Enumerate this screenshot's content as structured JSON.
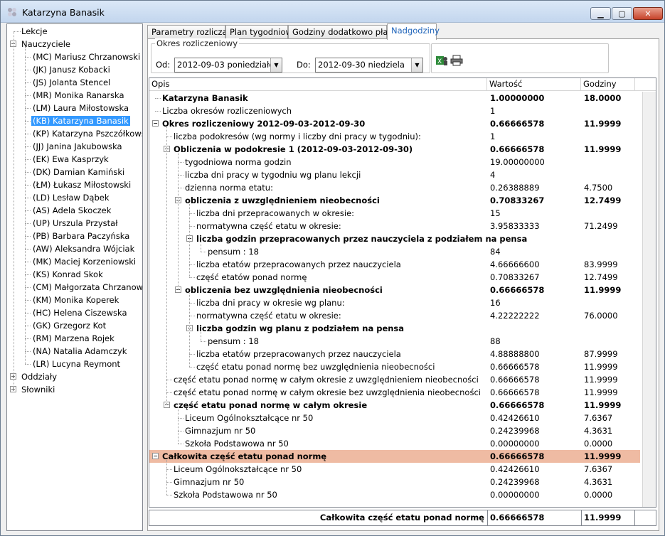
{
  "window": {
    "title": "Katarzyna Banasik",
    "min_glyph": "▁",
    "max_glyph": "▢",
    "close_glyph": "✕"
  },
  "tree": {
    "lekcje": "Lekcje",
    "nauczyciele": "Nauczyciele",
    "teachers": [
      "(MC) Mariusz Chrzanowski",
      "(JK) Janusz Kobacki",
      "(JS) Jolanta Stencel",
      "(MR) Monika Ranarska",
      "(LM) Laura Miłostowska",
      "(KB) Katarzyna Banasik",
      "(KP) Katarzyna Pszczółkowska",
      "(JJ) Janina Jakubowska",
      "(EK) Ewa Kasprzyk",
      "(DK) Damian Kamiński",
      "(ŁM) Łukasz Miłostowski",
      "(LD) Lesław Dąbek",
      "(AS) Adela Skoczek",
      "(UP) Urszula Przystał",
      "(PB) Barbara Paczyńska",
      "(AW) Aleksandra Wójciak",
      "(MK) Maciej Korzeniowski",
      "(KS) Konrad Skok",
      "(CM) Małgorzata Chrzanowska",
      "(KM) Monika Koperek",
      "(HC) Helena Ciszewska",
      "(GK) Grzegorz Kot",
      "(RM) Marzena Rojek",
      "(NA) Natalia Adamczyk",
      "(LR) Lucyna Reymont"
    ],
    "selected_index": 5,
    "oddzialy": "Oddziały",
    "slowniki": "Słowniki"
  },
  "tabs": [
    "Parametry rozliczania",
    "Plan tygodniowy",
    "Godziny dodatkowo płatne",
    "Nadgodziny"
  ],
  "active_tab": 3,
  "period": {
    "group_label": "Okres rozliczeniowy",
    "od_label": "Od:",
    "od_value": "2012-09-03 poniedziałek",
    "do_label": "Do:",
    "do_value": "2012-09-30 niedziela"
  },
  "grid": {
    "headers": [
      "Opis",
      "Wartość",
      "Godziny"
    ],
    "rows": [
      {
        "text": "Katarzyna Banasik",
        "v": "1.00000000",
        "h": "18.0000",
        "lvl": 0,
        "bold": true,
        "exp": false
      },
      {
        "text": "Liczba okresów rozliczeniowych",
        "v": "1",
        "h": "",
        "lvl": 0,
        "bold": false,
        "exp": false
      },
      {
        "text": "Okres rozliczeniowy 2012-09-03-2012-09-30",
        "v": "0.66666578",
        "h": "11.9999",
        "lvl": 0,
        "bold": true,
        "exp": true
      },
      {
        "text": "liczba podokresów (wg normy i liczby dni pracy w tygodniu):",
        "v": "1",
        "h": "",
        "lvl": 1,
        "bold": false,
        "exp": false
      },
      {
        "text": "Obliczenia w podokresie 1 (2012-09-03-2012-09-30)",
        "v": "0.66666578",
        "h": "11.9999",
        "lvl": 1,
        "bold": true,
        "exp": true
      },
      {
        "text": "tygodniowa norma godzin",
        "v": "19.00000000",
        "h": "",
        "lvl": 2,
        "bold": false,
        "exp": false
      },
      {
        "text": "liczba dni pracy w tygodniu wg planu lekcji",
        "v": "4",
        "h": "",
        "lvl": 2,
        "bold": false,
        "exp": false
      },
      {
        "text": "dzienna norma etatu:",
        "v": "0.26388889",
        "h": "4.7500",
        "lvl": 2,
        "bold": false,
        "exp": false
      },
      {
        "text": "obliczenia z  uwzględnieniem nieobecności",
        "v": "0.70833267",
        "h": "12.7499",
        "lvl": 2,
        "bold": true,
        "exp": true
      },
      {
        "text": "liczba dni przepracowanych w okresie:",
        "v": "15",
        "h": "",
        "lvl": 3,
        "bold": false,
        "exp": false
      },
      {
        "text": "normatywna część etatu w okresie:",
        "v": "3.95833333",
        "h": "71.2499",
        "lvl": 3,
        "bold": false,
        "exp": false
      },
      {
        "text": "liczba godzin przepracowanych przez nauczyciela z podziałem na pensa",
        "v": "",
        "h": "",
        "lvl": 3,
        "bold": true,
        "exp": true
      },
      {
        "text": "pensum : 18",
        "v": "84",
        "h": "",
        "lvl": 4,
        "bold": false,
        "exp": false
      },
      {
        "text": "liczba etatów przepracowanych przez nauczyciela",
        "v": "4.66666600",
        "h": "83.9999",
        "lvl": 3,
        "bold": false,
        "exp": false
      },
      {
        "text": "część etatów ponad normę",
        "v": "0.70833267",
        "h": "12.7499",
        "lvl": 3,
        "bold": false,
        "exp": false
      },
      {
        "text": "obliczenia bez  uwzględnienia nieobecności",
        "v": "0.66666578",
        "h": "11.9999",
        "lvl": 2,
        "bold": true,
        "exp": true
      },
      {
        "text": "liczba dni pracy w okresie wg planu:",
        "v": "16",
        "h": "",
        "lvl": 3,
        "bold": false,
        "exp": false
      },
      {
        "text": "normatywna część etatu w okresie:",
        "v": "4.22222222",
        "h": "76.0000",
        "lvl": 3,
        "bold": false,
        "exp": false
      },
      {
        "text": "liczba godzin wg planu z podziałem na pensa",
        "v": "",
        "h": "",
        "lvl": 3,
        "bold": true,
        "exp": true
      },
      {
        "text": "pensum : 18",
        "v": "88",
        "h": "",
        "lvl": 4,
        "bold": false,
        "exp": false
      },
      {
        "text": "liczba etatów przepracowanych przez nauczyciela",
        "v": "4.88888800",
        "h": "87.9999",
        "lvl": 3,
        "bold": false,
        "exp": false
      },
      {
        "text": "część etatu ponad normę bez uwzględnienia nieobecności",
        "v": "0.66666578",
        "h": "11.9999",
        "lvl": 3,
        "bold": false,
        "exp": false
      },
      {
        "text": "część etatu ponad normę w całym okresie  z uwzględnieniem nieobecności",
        "v": "0.66666578",
        "h": "11.9999",
        "lvl": 1,
        "bold": false,
        "exp": false
      },
      {
        "text": "część etatu ponad normę w całym okresie  bez uwzględnienia nieobecności",
        "v": "0.66666578",
        "h": "11.9999",
        "lvl": 1,
        "bold": false,
        "exp": false
      },
      {
        "text": "część etatu ponad normę w całym okresie",
        "v": "0.66666578",
        "h": "11.9999",
        "lvl": 1,
        "bold": true,
        "exp": true
      },
      {
        "text": "Liceum Ogólnokształcące nr 50",
        "v": "0.42426610",
        "h": "7.6367",
        "lvl": 2,
        "bold": false,
        "exp": false
      },
      {
        "text": "Gimnazjum nr 50",
        "v": "0.24239968",
        "h": "4.3631",
        "lvl": 2,
        "bold": false,
        "exp": false
      },
      {
        "text": "Szkoła Podstawowa nr 50",
        "v": "0.00000000",
        "h": "0.0000",
        "lvl": 2,
        "bold": false,
        "exp": false
      },
      {
        "text": "Całkowita część etatu ponad normę",
        "v": "0.66666578",
        "h": "11.9999",
        "lvl": 0,
        "bold": true,
        "exp": true,
        "hl": true
      },
      {
        "text": "Liceum Ogólnokształcące nr 50",
        "v": "0.42426610",
        "h": "7.6367",
        "lvl": 1,
        "bold": false,
        "exp": false
      },
      {
        "text": "Gimnazjum nr 50",
        "v": "0.24239968",
        "h": "4.3631",
        "lvl": 1,
        "bold": false,
        "exp": false
      },
      {
        "text": "Szkoła Podstawowa nr 50",
        "v": "0.00000000",
        "h": "0.0000",
        "lvl": 1,
        "bold": false,
        "exp": false
      }
    ]
  },
  "footer": {
    "label": "Całkowita część etatu ponad normę",
    "value": "0.66666578",
    "hours": "11.9999"
  },
  "colors": {
    "highlight": "#efbba3",
    "selection": "#3399ff",
    "active_tab_text": "#2266bb"
  },
  "icons": [
    "tree-app-icon",
    "export-excel-icon",
    "print-icon"
  ]
}
